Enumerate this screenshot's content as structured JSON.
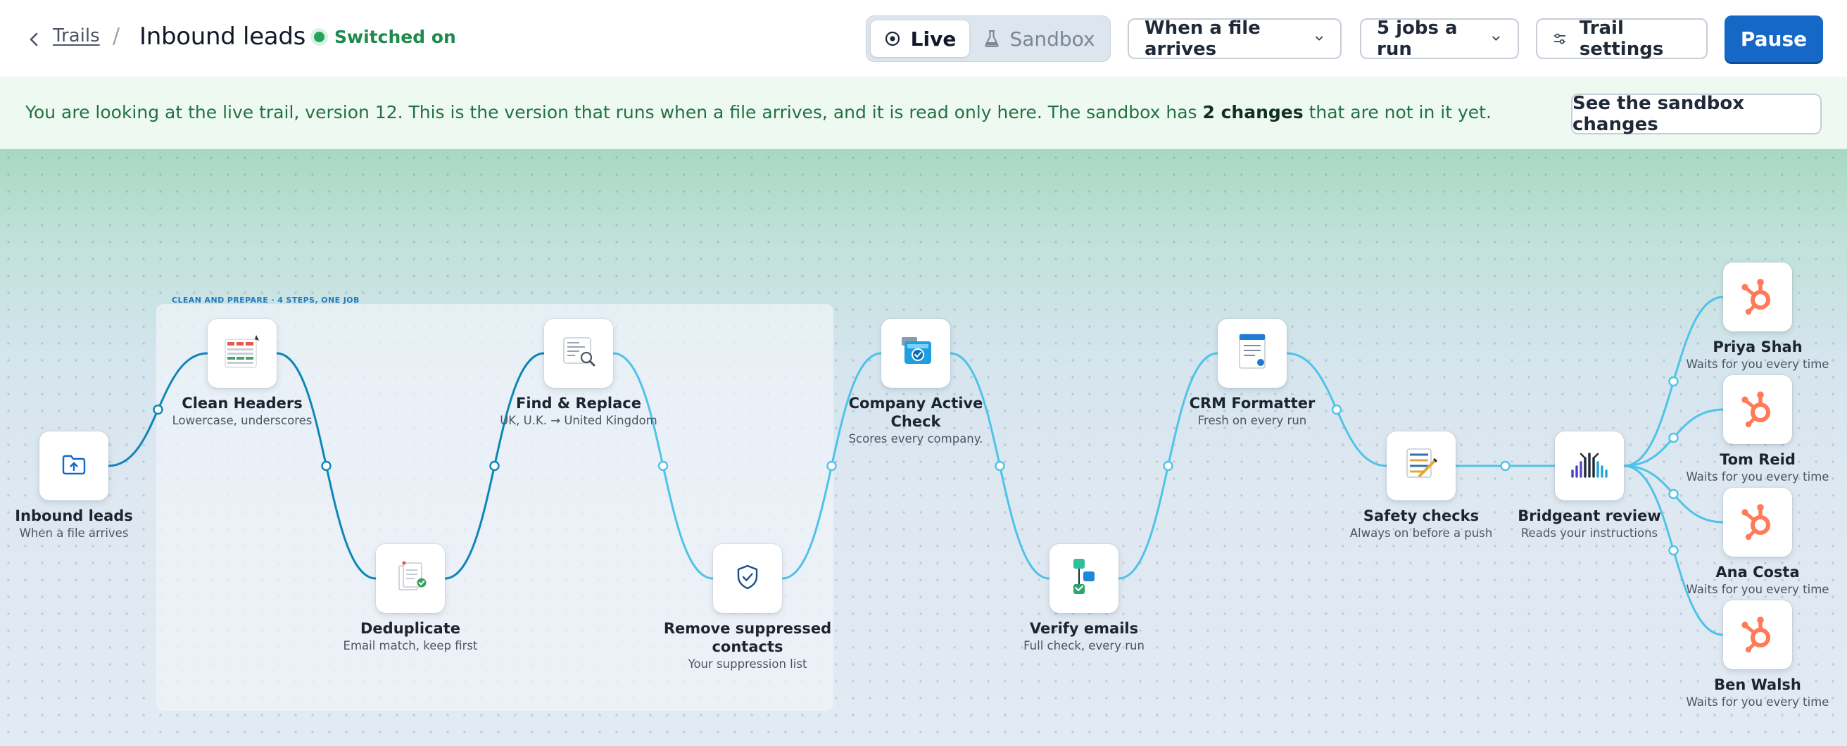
{
  "header": {
    "breadcrumb_parent": "Trails",
    "breadcrumb_sep": "/",
    "title": "Inbound leads",
    "status": "Switched on",
    "mode": {
      "live": "Live",
      "sandbox": "Sandbox",
      "selected": "Live"
    },
    "trigger": "When a file arrives",
    "jobs": "5 jobs a run",
    "settings": "Trail settings",
    "pause": "Pause"
  },
  "banner": {
    "text_before": "You are looking at the live trail, version 12. This is the version that runs when a file arrives, and it is read only here. The sandbox has ",
    "text_bold": "2 changes",
    "text_after": " that are not in it yet.",
    "button": "See the sandbox changes"
  },
  "canvas": {
    "group_label": "CLEAN AND PREPARE · 4 STEPS, ONE JOB",
    "nodes": [
      {
        "id": "trigger",
        "title": "Inbound leads",
        "sub": "When a file arrives",
        "icon": "folder-upload-icon"
      },
      {
        "id": "clean-headers",
        "title": "Clean Headers",
        "sub": "Lowercase, underscores",
        "icon": "table-headers-icon"
      },
      {
        "id": "deduplicate",
        "title": "Deduplicate",
        "sub": "Email match, keep first",
        "icon": "duplicate-docs-icon"
      },
      {
        "id": "find-replace",
        "title": "Find & Replace",
        "sub": "UK, U.K. → United Kingdom",
        "icon": "find-replace-icon"
      },
      {
        "id": "remove-suppressed",
        "title": "Remove suppressed\ncontacts",
        "sub": "Your suppression list",
        "icon": "shield-check-icon"
      },
      {
        "id": "company-active",
        "title": "Company Active\nCheck",
        "sub": "Scores every company.",
        "icon": "company-check-icon"
      },
      {
        "id": "verify-emails",
        "title": "Verify emails",
        "sub": "Full check, every run",
        "icon": "verify-flow-icon"
      },
      {
        "id": "crm-formatter",
        "title": "CRM Formatter",
        "sub": "Fresh on every run",
        "icon": "crm-form-icon"
      },
      {
        "id": "safety-checks",
        "title": "Safety checks",
        "sub": "Always on before a push",
        "icon": "safety-checklist-icon"
      },
      {
        "id": "bridgeant-review",
        "title": "Bridgeant review",
        "sub": "Reads your instructions",
        "icon": "bridgeant-logo-icon"
      },
      {
        "id": "priya",
        "title": "Priya Shah",
        "sub": "Waits for you every time",
        "icon": "hubspot-icon"
      },
      {
        "id": "tom",
        "title": "Tom Reid",
        "sub": "Waits for you every time",
        "icon": "hubspot-icon"
      },
      {
        "id": "ana",
        "title": "Ana Costa",
        "sub": "Waits for you every time",
        "icon": "hubspot-icon"
      },
      {
        "id": "ben",
        "title": "Ben Walsh",
        "sub": "Waits for you every time",
        "icon": "hubspot-icon"
      }
    ]
  },
  "colors": {
    "accent": "#1668c6",
    "status_green": "#22a55b",
    "wire_dark": "#0f86b8",
    "wire_light": "#4fc3e8",
    "hubspot": "#ff7a59"
  }
}
